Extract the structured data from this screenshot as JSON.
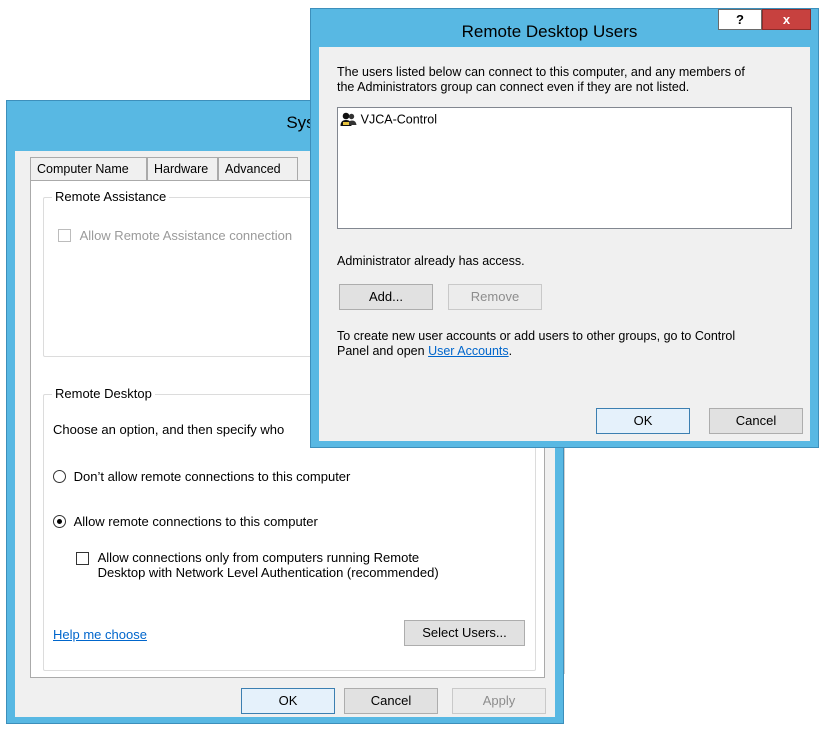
{
  "system_properties": {
    "title": "System Prop",
    "tabs": [
      "Computer Name",
      "Hardware",
      "Advanced"
    ],
    "remote_assistance": {
      "group_label": "Remote Assistance",
      "allow_label": "Allow Remote Assistance connection",
      "allow_checked": false,
      "allow_enabled": false
    },
    "remote_desktop": {
      "group_label": "Remote Desktop",
      "instruction": "Choose an option, and then specify who",
      "option_dont_allow": "Don’t allow remote connections to this computer",
      "option_allow": "Allow remote connections to this computer",
      "selected_option": "allow",
      "nla_line1": "Allow connections only from computers running Remote",
      "nla_line2": "Desktop with Network Level Authentication (recommended)",
      "nla_checked": false,
      "help_link": "Help me choose",
      "select_users_label": "Select Users..."
    },
    "buttons": {
      "ok": "OK",
      "cancel": "Cancel",
      "apply": "Apply"
    }
  },
  "remote_desktop_users": {
    "title": "Remote Desktop Users",
    "help_glyph": "?",
    "close_glyph": "x",
    "description_line1": "The users listed below can connect to this computer, and any members of",
    "description_line2": "the Administrators group can connect even if they are not listed.",
    "users": [
      "VJCA-Control"
    ],
    "admin_note": "Administrator already has access.",
    "add_label": "Add...",
    "remove_label": "Remove",
    "accounts_text_line1": "To create new user accounts or add users to other groups, go to Control",
    "accounts_text_line2_prefix": "Panel and open ",
    "accounts_link": "User Accounts",
    "accounts_text_line2_suffix": ".",
    "ok_label": "OK",
    "cancel_label": "Cancel"
  },
  "colors": {
    "window_frame": "#58b8e3",
    "close_button": "#c7413f",
    "link": "#0066cc",
    "client_bg": "#f0f0f0"
  }
}
